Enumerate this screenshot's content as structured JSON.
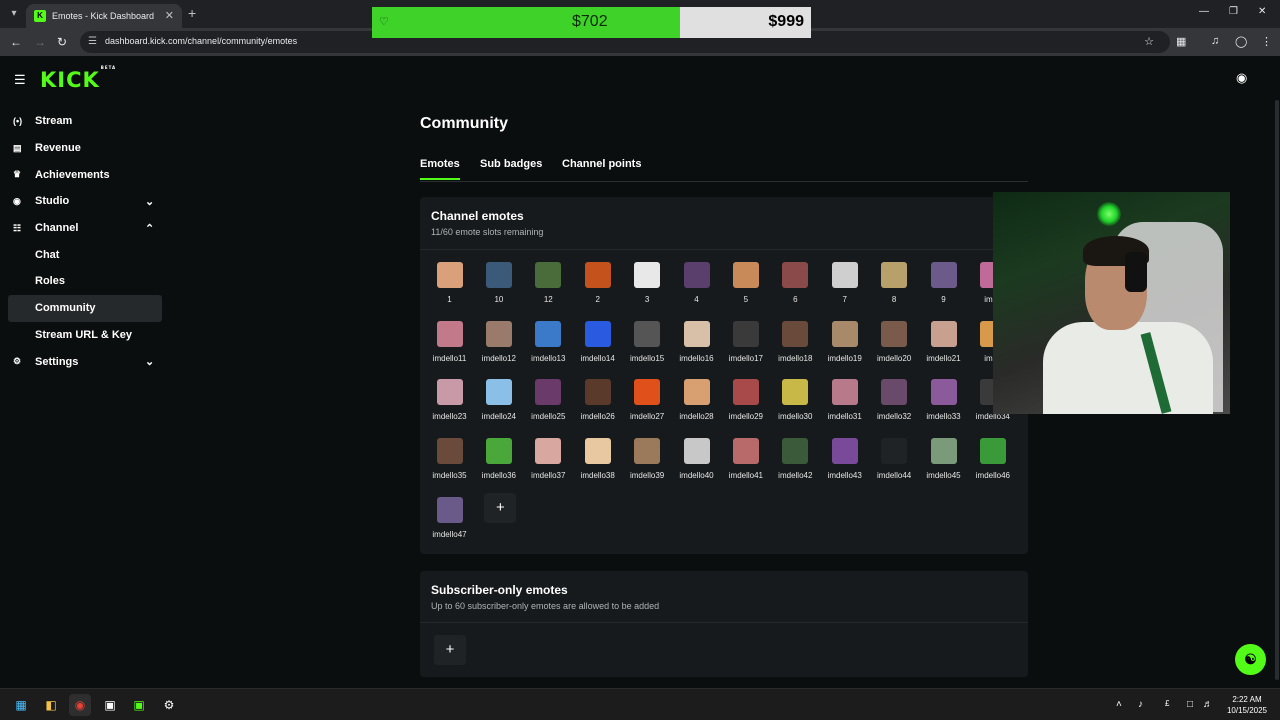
{
  "browser": {
    "tab_title": "Emotes - Kick Dashboard",
    "tab_favicon": "K",
    "url": "dashboard.kick.com/channel/community/emotes",
    "icons": [
      "tab-list-icon",
      "close-icon",
      "new-tab-icon",
      "minimize-icon",
      "maximize-icon",
      "window-close-icon",
      "back-icon",
      "forward-icon",
      "reload-icon",
      "site-info-icon",
      "star-icon",
      "extensions-icon",
      "media-icon",
      "profile-icon",
      "menu-icon"
    ]
  },
  "goal": {
    "current": "$702",
    "target": "$999",
    "progress": 0.7027,
    "accent": "#3fd32a"
  },
  "brand": {
    "logo": "KICK",
    "beta": "BETA",
    "accent": "#53fc18"
  },
  "sidebar": {
    "items": [
      {
        "label": "Stream",
        "icon": "stream-icon"
      },
      {
        "label": "Revenue",
        "icon": "revenue-icon"
      },
      {
        "label": "Achievements",
        "icon": "trophy-icon"
      },
      {
        "label": "Studio",
        "icon": "studio-icon",
        "chevron": "down"
      },
      {
        "label": "Channel",
        "icon": "channel-icon",
        "chevron": "up"
      },
      {
        "label": "Chat"
      },
      {
        "label": "Roles"
      },
      {
        "label": "Community",
        "active": true
      },
      {
        "label": "Stream URL & Key"
      },
      {
        "label": "Settings",
        "icon": "gear-icon",
        "chevron": "down"
      }
    ]
  },
  "page": {
    "title": "Community",
    "tabs": [
      "Emotes",
      "Sub badges",
      "Channel points"
    ],
    "selected_tab": "Emotes"
  },
  "channel_emotes": {
    "heading": "Channel emotes",
    "subtitle": "11/60 emote slots remaining",
    "add_label": "+",
    "emotes": [
      {
        "label": "1",
        "color": "#d9a07a"
      },
      {
        "label": "10",
        "color": "#3b5a7a"
      },
      {
        "label": "12",
        "color": "#4a6b3a"
      },
      {
        "label": "2",
        "color": "#c4521c"
      },
      {
        "label": "3",
        "color": "#e8e8e8"
      },
      {
        "label": "4",
        "color": "#5a3e6b"
      },
      {
        "label": "5",
        "color": "#c98a5a"
      },
      {
        "label": "6",
        "color": "#8a4a4a"
      },
      {
        "label": "7",
        "color": "#cfcfcf"
      },
      {
        "label": "8",
        "color": "#b8a06a"
      },
      {
        "label": "9",
        "color": "#6b5a8a"
      },
      {
        "label": "imde",
        "color": "#c06a9a"
      },
      {
        "label": "imdello11",
        "color": "#c27a8a"
      },
      {
        "label": "imdello12",
        "color": "#9a7a6a"
      },
      {
        "label": "imdello13",
        "color": "#3a7ac8"
      },
      {
        "label": "imdello14",
        "color": "#2a5ae0"
      },
      {
        "label": "imdello15",
        "color": "#555555"
      },
      {
        "label": "imdello16",
        "color": "#d8c0a8"
      },
      {
        "label": "imdello17",
        "color": "#3a3a3a"
      },
      {
        "label": "imdello18",
        "color": "#6a4a3a"
      },
      {
        "label": "imdello19",
        "color": "#a88a6a"
      },
      {
        "label": "imdello20",
        "color": "#7a5a4a"
      },
      {
        "label": "imdello21",
        "color": "#c8a090"
      },
      {
        "label": "imde",
        "color": "#d89a4a"
      },
      {
        "label": "imdello23",
        "color": "#c89aa8"
      },
      {
        "label": "imdello24",
        "color": "#8ac0e8"
      },
      {
        "label": "imdello25",
        "color": "#6a3a6a"
      },
      {
        "label": "imdello26",
        "color": "#5a3a2a"
      },
      {
        "label": "imdello27",
        "color": "#e0501a"
      },
      {
        "label": "imdello28",
        "color": "#d8a070"
      },
      {
        "label": "imdello29",
        "color": "#a84a4a"
      },
      {
        "label": "imdello30",
        "color": "#c8b848"
      },
      {
        "label": "imdello31",
        "color": "#b87a8a"
      },
      {
        "label": "imdello32",
        "color": "#6a4a6a"
      },
      {
        "label": "imdello33",
        "color": "#8a5a9a"
      },
      {
        "label": "imdello34",
        "color": "#3a3a3a"
      },
      {
        "label": "imdello35",
        "color": "#6a4a3a"
      },
      {
        "label": "imdello36",
        "color": "#4aa83a"
      },
      {
        "label": "imdello37",
        "color": "#d8a8a0"
      },
      {
        "label": "imdello38",
        "color": "#e8c8a0"
      },
      {
        "label": "imdello39",
        "color": "#9a7a5a"
      },
      {
        "label": "imdello40",
        "color": "#c8c8c8"
      },
      {
        "label": "imdello41",
        "color": "#b86a6a"
      },
      {
        "label": "imdello42",
        "color": "#3a5a3a"
      },
      {
        "label": "imdello43",
        "color": "#7a4a9a"
      },
      {
        "label": "imdello44",
        "color": "#1f2325"
      },
      {
        "label": "imdello45",
        "color": "#7a9a7a"
      },
      {
        "label": "imdello46",
        "color": "#3a9a3a"
      },
      {
        "label": "imdello47",
        "color": "#6a5a8a"
      }
    ]
  },
  "subscriber_emotes": {
    "heading": "Subscriber-only emotes",
    "subtitle": "Up to 60 subscriber-only emotes are allowed to be added",
    "add_label": "+"
  },
  "taskbar": {
    "apps": [
      "windows-start-icon",
      "file-explorer-icon",
      "chrome-icon",
      "app-icon",
      "app-icon-2",
      "app-icon-3"
    ],
    "time": "2:22 AM",
    "date": "10/15/2025"
  }
}
